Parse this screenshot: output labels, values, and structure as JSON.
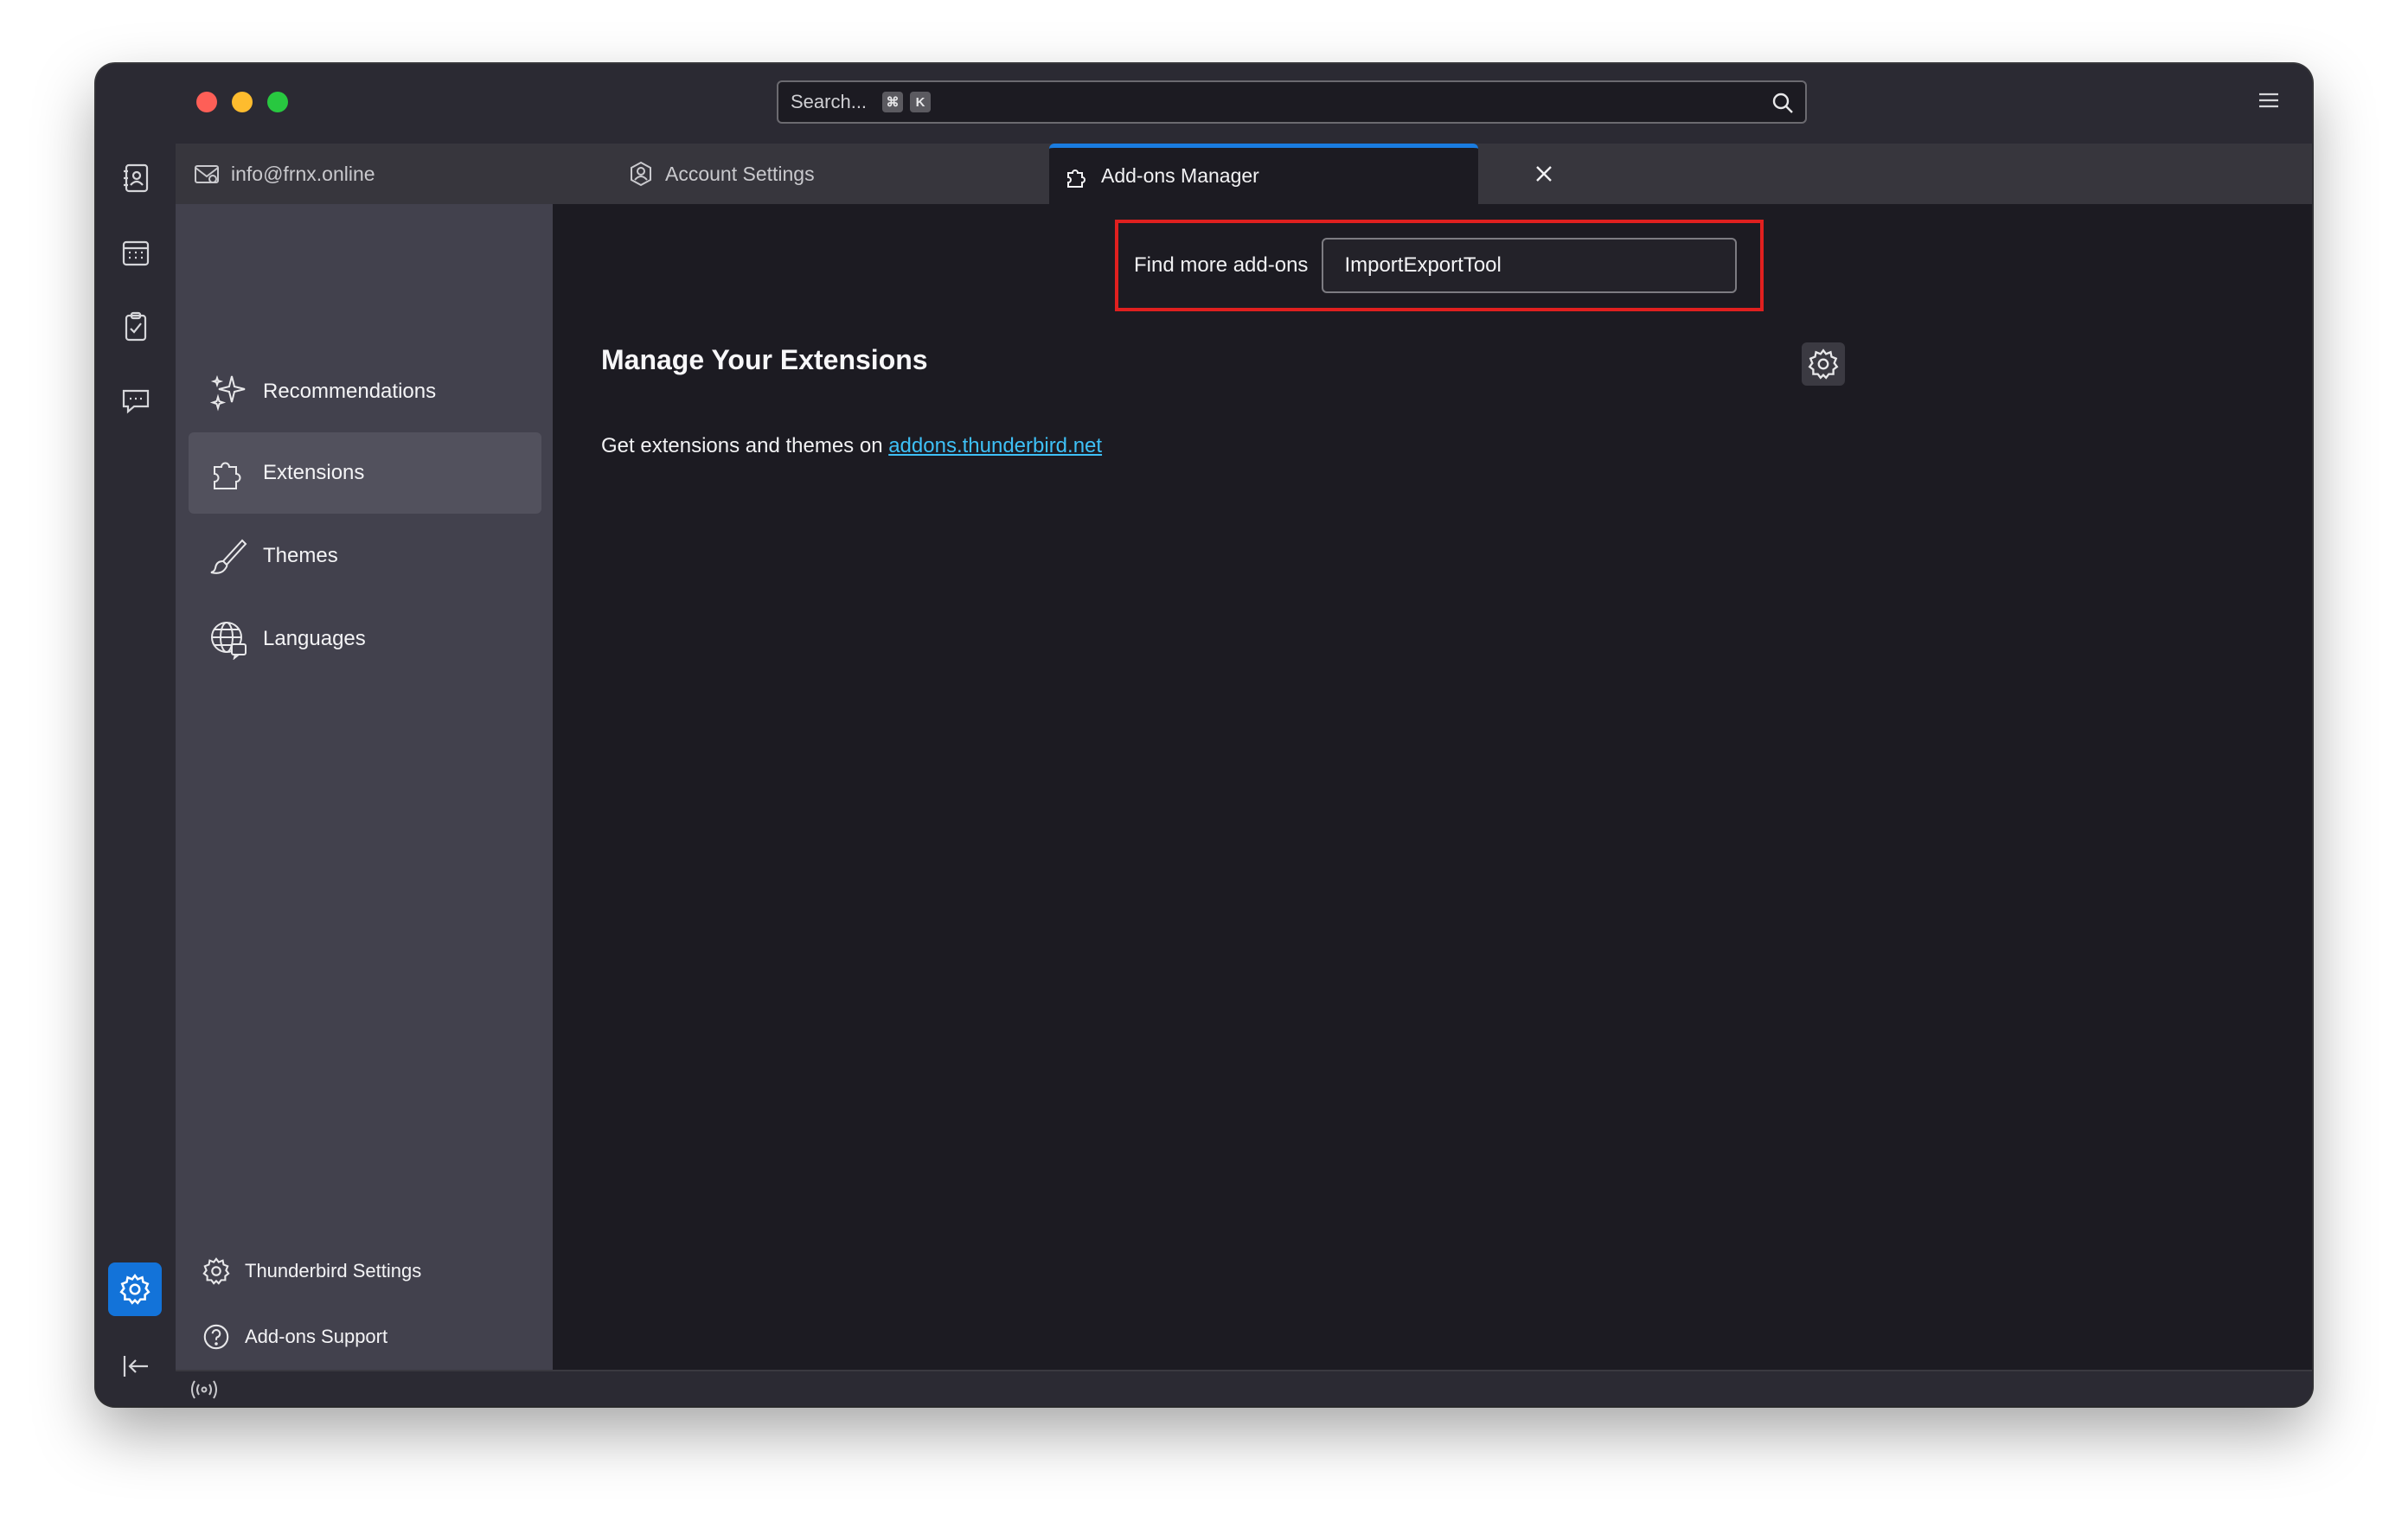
{
  "search": {
    "placeholder": "Search...",
    "shortcut_keys": [
      "⌘",
      "K"
    ]
  },
  "tabs": [
    {
      "label": "info@frnx.online",
      "icon": "mail-icon",
      "closable": false,
      "active": false
    },
    {
      "label": "Account Settings",
      "icon": "account-settings-icon",
      "closable": true,
      "active": false
    },
    {
      "label": "Add-ons Manager",
      "icon": "puzzle-icon",
      "closable": true,
      "active": true
    }
  ],
  "sidebar": {
    "categories": [
      {
        "label": "Recommendations",
        "icon": "sparkle-icon",
        "selected": false
      },
      {
        "label": "Extensions",
        "icon": "puzzle-icon",
        "selected": true
      },
      {
        "label": "Themes",
        "icon": "brush-icon",
        "selected": false
      },
      {
        "label": "Languages",
        "icon": "globe-icon",
        "selected": false
      }
    ],
    "footer": [
      {
        "label": "Thunderbird Settings",
        "icon": "gear-icon"
      },
      {
        "label": "Add-ons Support",
        "icon": "help-icon"
      }
    ]
  },
  "main": {
    "find_label": "Find more add-ons",
    "find_value": "ImportExportTool",
    "heading": "Manage Your Extensions",
    "info_prefix": "Get extensions and themes on ",
    "info_link": "addons.thunderbird.net"
  },
  "spaces": [
    "mail-icon",
    "address-book-icon",
    "calendar-icon",
    "tasks-icon",
    "chat-icon",
    "settings-icon",
    "collapse-icon"
  ],
  "colors": {
    "accent": "#1a7ce0",
    "link": "#3ec0f6",
    "highlight_border": "#e0201f"
  }
}
